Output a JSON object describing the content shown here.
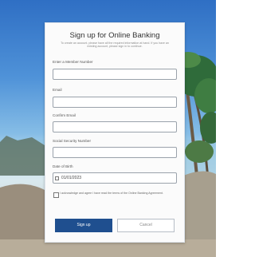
{
  "form": {
    "title": "Sign up for Online Banking",
    "subtitle": "To create an account, please have all the required information at hand. If you have an existing account, please sign in to continue.",
    "fields": [
      {
        "label": "Enter a Member Number",
        "value": ""
      },
      {
        "label": "Email",
        "value": ""
      },
      {
        "label": "Confirm Email",
        "value": ""
      },
      {
        "label": "Social Security Number",
        "value": ""
      },
      {
        "label": "Date of Birth",
        "value": "01/01/2023"
      }
    ],
    "terms_text": "I acknowledge and agree I have read the terms of the Online Banking Agreement.",
    "terms_checked": false,
    "signup_label": "Sign up",
    "cancel_label": "Cancel"
  },
  "colors": {
    "primary": "#1f4f8f",
    "card": "#fbfbfb"
  }
}
